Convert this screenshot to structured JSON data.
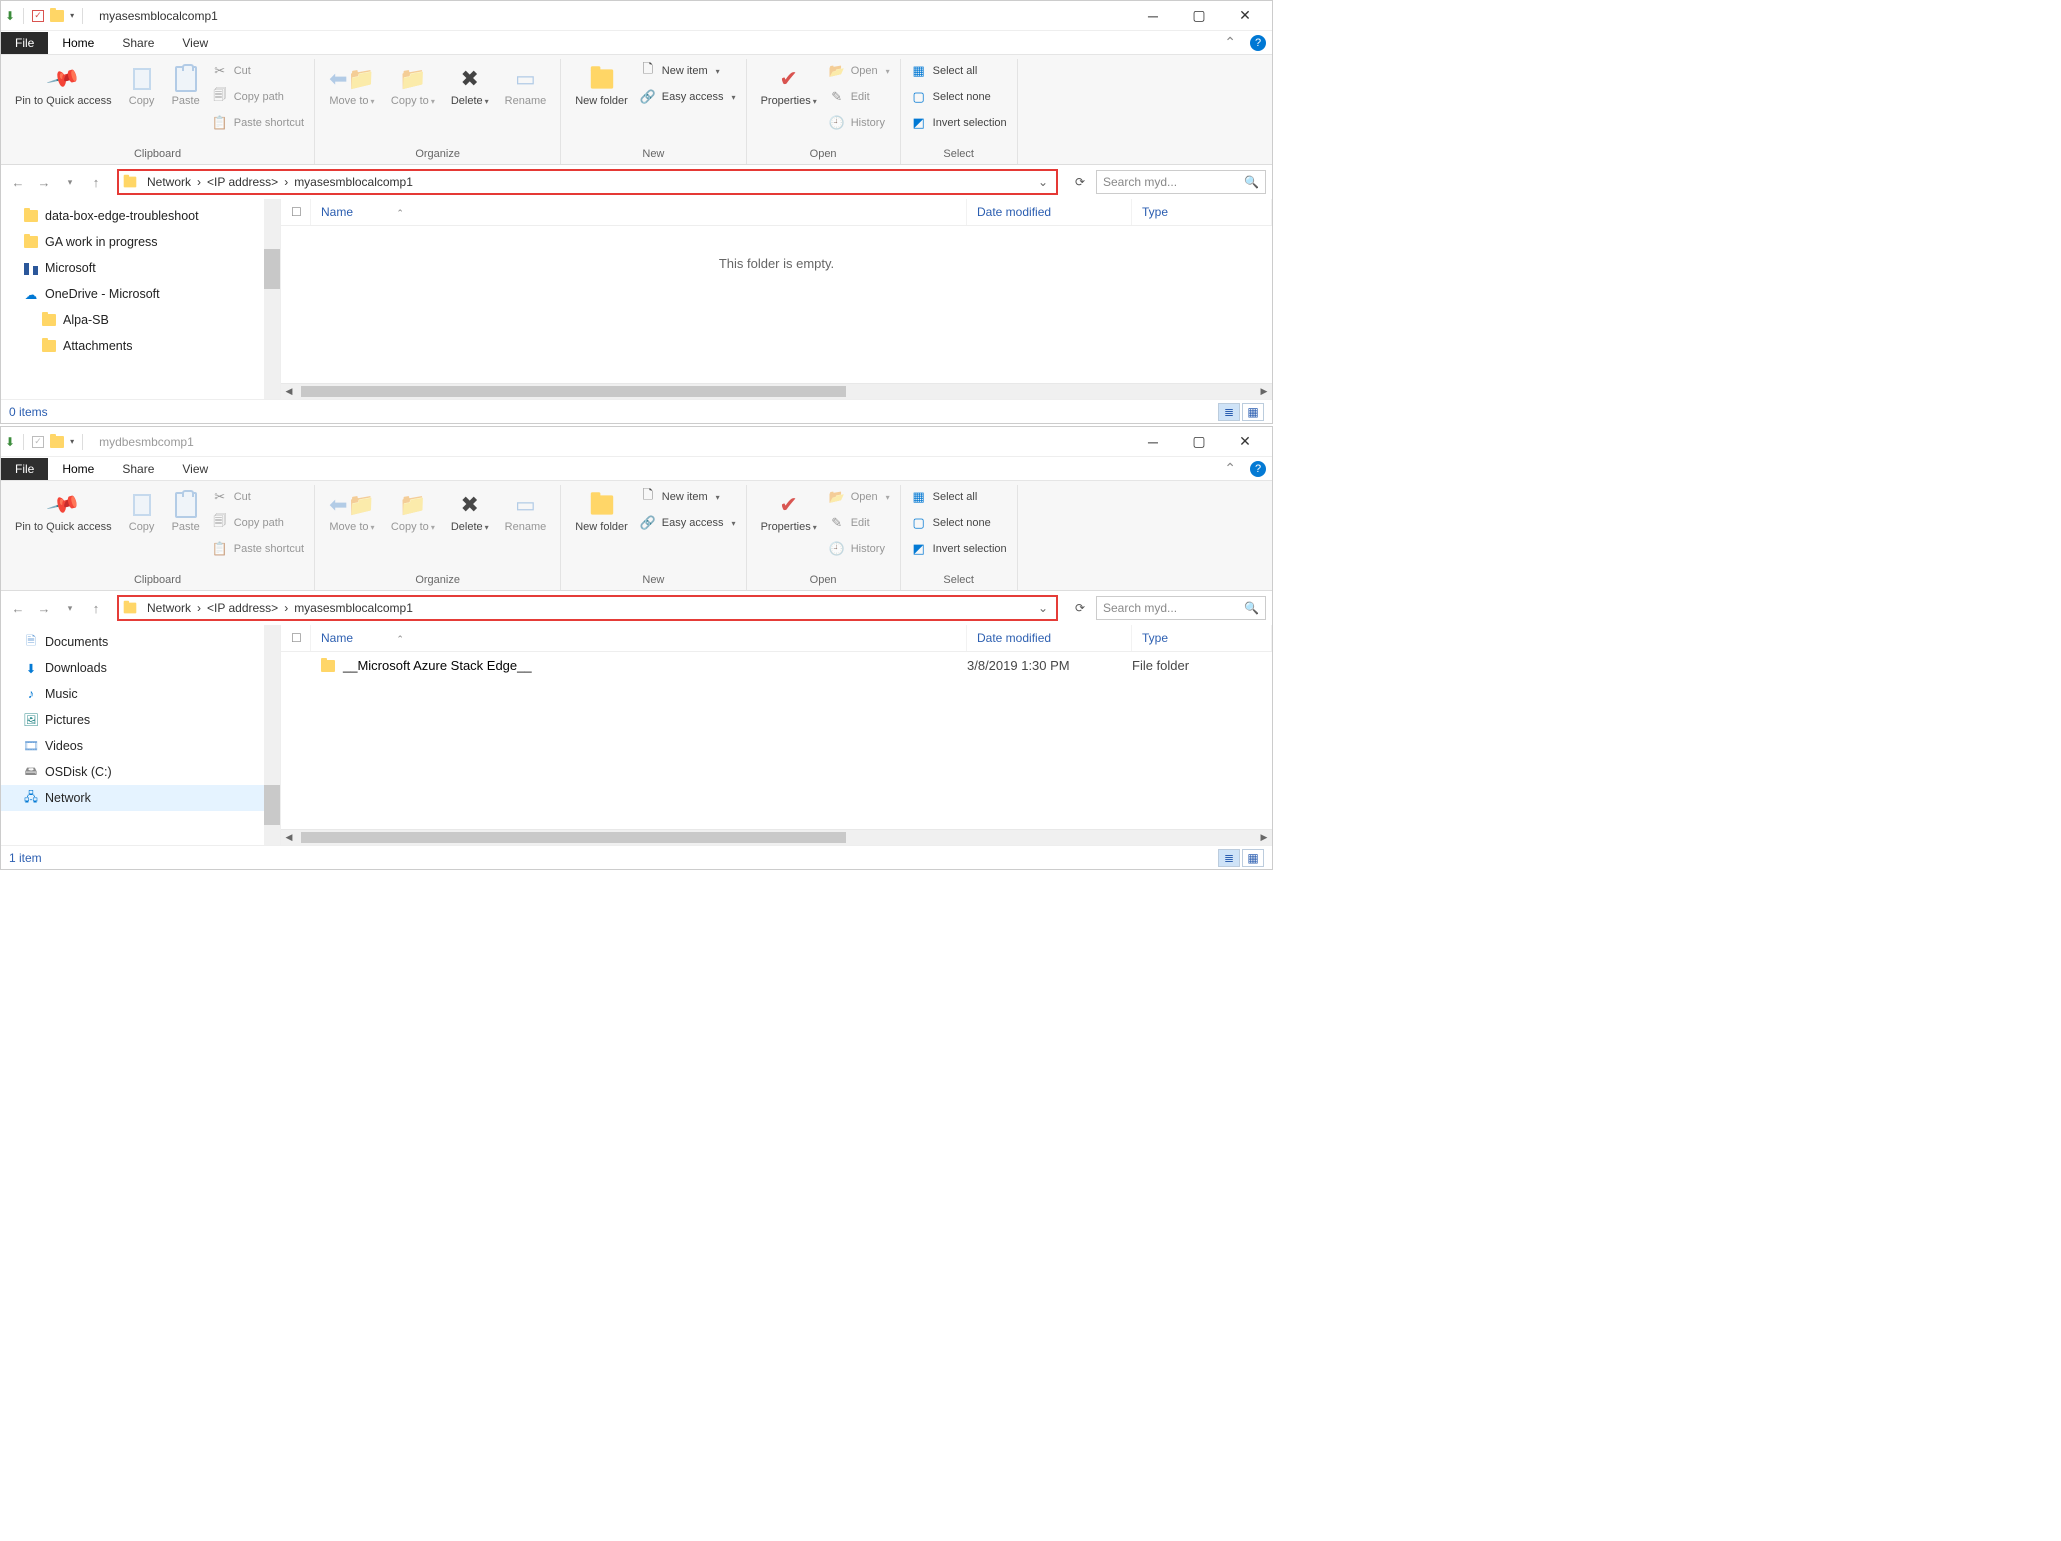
{
  "window1": {
    "title": "myasesmblocalcomp1",
    "menutabs": {
      "file": "File",
      "home": "Home",
      "share": "Share",
      "view": "View"
    },
    "breadcrumb": [
      "Network",
      "<IP address>",
      "myasesmblocalcomp1"
    ],
    "search_placeholder": "Search myd...",
    "tree": [
      {
        "label": "data-box-edge-troubleshoot",
        "icon": "folder",
        "lvl": 1
      },
      {
        "label": "GA work in progress",
        "icon": "folder",
        "lvl": 1
      },
      {
        "label": "Microsoft",
        "icon": "buildings",
        "lvl": 1
      },
      {
        "label": "OneDrive - Microsoft",
        "icon": "cloud",
        "lvl": 1
      },
      {
        "label": "Alpa-SB",
        "icon": "folder",
        "lvl": 2
      },
      {
        "label": "Attachments",
        "icon": "folder",
        "lvl": 2
      }
    ],
    "columns": {
      "name": "Name",
      "date": "Date modified",
      "type": "Type"
    },
    "empty": "This folder is empty.",
    "status": "0 items"
  },
  "window2": {
    "title": "mydbesmbcomp1",
    "menutabs": {
      "file": "File",
      "home": "Home",
      "share": "Share",
      "view": "View"
    },
    "breadcrumb": [
      "Network",
      "<IP address>",
      "myasesmblocalcomp1"
    ],
    "search_placeholder": "Search myd...",
    "tree": [
      {
        "label": "Documents",
        "icon": "doc"
      },
      {
        "label": "Downloads",
        "icon": "down"
      },
      {
        "label": "Music",
        "icon": "music"
      },
      {
        "label": "Pictures",
        "icon": "pic"
      },
      {
        "label": "Videos",
        "icon": "vid"
      },
      {
        "label": "OSDisk (C:)",
        "icon": "disk"
      },
      {
        "label": "Network",
        "icon": "net",
        "sel": true
      }
    ],
    "columns": {
      "name": "Name",
      "date": "Date modified",
      "type": "Type"
    },
    "rows": [
      {
        "name": "__Microsoft Azure Stack Edge__",
        "date": "3/8/2019 1:30 PM",
        "type": "File folder"
      }
    ],
    "status": "1 item"
  },
  "ribbon": {
    "clipboard": {
      "label": "Clipboard",
      "pin": "Pin to Quick access",
      "copy": "Copy",
      "paste": "Paste",
      "cut": "Cut",
      "copypath": "Copy path",
      "pasteshort": "Paste shortcut"
    },
    "organize": {
      "label": "Organize",
      "move": "Move to",
      "copy": "Copy to",
      "delete": "Delete",
      "rename": "Rename"
    },
    "new": {
      "label": "New",
      "folder": "New folder",
      "item": "New item",
      "easy": "Easy access"
    },
    "open": {
      "label": "Open",
      "props": "Properties",
      "open": "Open",
      "edit": "Edit",
      "history": "History"
    },
    "select": {
      "label": "Select",
      "all": "Select all",
      "none": "Select none",
      "invert": "Invert selection"
    }
  }
}
